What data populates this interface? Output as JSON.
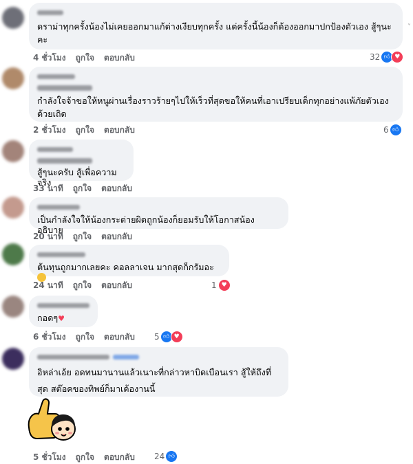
{
  "comments": [
    {
      "text": "ดราม่าทุกครั้งน้องไม่เคยออกมาแก้ต่างเงียบทุกครั้ง แต่ครั้งนี้น้องก็ต้องออกมาปกป้องตัวเอง สู้ๆนะคะ",
      "time": "4 ชั่วโมง",
      "like": "ถูกใจ",
      "reply": "ตอบกลับ",
      "count": "32",
      "avatar_color": "#6e6f78"
    },
    {
      "text": "กำลังใจจ้าขอให้หนูผ่านเรื่องราวร้ายๆไปให้เร็วที่สุดขอให้คนที่เอาเปรียบเด็กทุกอย่างแพ้ภัยตัวเองด้วยเถิด",
      "time": "2 ชั่วโมง",
      "like": "ถูกใจ",
      "reply": "ตอบกลับ",
      "count": "6",
      "avatar_color": "#b08a6a"
    },
    {
      "text": "สู้ๆนะครับ สู้เพื่อความจริง",
      "time": "33 นาที",
      "like": "ถูกใจ",
      "reply": "ตอบกลับ",
      "count": "",
      "avatar_color": "#a3847a"
    },
    {
      "text": "เป็นกำลังใจให้น้องกระต่ายผิดถูกน้องก็ยอมรับให้โอกาสน้องอธิบาย",
      "time": "20 นาที",
      "like": "ถูกใจ",
      "reply": "ตอบกลับ",
      "count": "",
      "avatar_color": "#c49a8e"
    },
    {
      "text": "ต้นทุนถูกมากเลยคะ คอลลาเจน มากสุดก็กรัมอะ",
      "time": "24 นาที",
      "like": "ถูกใจ",
      "reply": "ตอบกลับ",
      "count": "1",
      "avatar_color": "#4e7a4a"
    },
    {
      "text": "กอดๆ",
      "time": "6 ชั่วโมง",
      "like": "ถูกใจ",
      "reply": "ตอบกลับ",
      "count": "5",
      "avatar_color": "#9a8680"
    },
    {
      "text": "อิหล่าเอ้ย อดทนมานานแล้วเนาะที่กล่าวหาบิดเบือนเรา สู้ให้ถึงที่สุด สต๊อคของทิพย์ก็มาเด้องานนี้",
      "time": "5 ชั่วโมง",
      "like": "ถูกใจ",
      "reply": "ตอบกลับ",
      "count": "24",
      "avatar_color": "#3c2e5e"
    }
  ],
  "icons": {
    "like": "like-reaction-icon",
    "love": "love-reaction-icon",
    "sticker": "thumbs-up-sticker"
  }
}
